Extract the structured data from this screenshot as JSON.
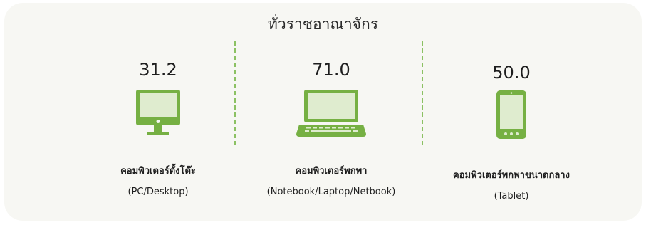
{
  "title": "ทั่วราชอาณาจักร",
  "items": [
    {
      "value": "31.2",
      "label": "คอมพิวเตอร์ตั้งโต๊ะ",
      "sublabel": "(PC/Desktop)",
      "icon": "desktop-computer-icon"
    },
    {
      "value": "71.0",
      "label": "คอมพิวเตอร์พกพา",
      "sublabel": "(Notebook/Laptop/Netbook)",
      "icon": "laptop-icon"
    },
    {
      "value": "50.0",
      "label": "คอมพิวเตอร์พกพาขนาดกลาง",
      "sublabel": "(Tablet)",
      "icon": "tablet-icon"
    }
  ],
  "colors": {
    "icon_green": "#76b043",
    "icon_screen": "#dfeccf",
    "divider": "#8cc163",
    "panel_bg": "#f7f7f3"
  }
}
